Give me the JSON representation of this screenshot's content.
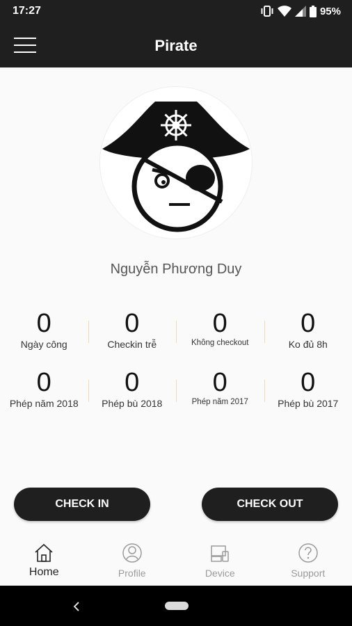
{
  "status_bar": {
    "time": "17:27",
    "battery_percent": "95%",
    "icons": [
      "vibrate-icon",
      "wifi-icon",
      "signal-icon",
      "battery-icon"
    ]
  },
  "app_bar": {
    "title": "Pirate",
    "menu_icon": "hamburger-menu-icon"
  },
  "profile": {
    "avatar_icon": "pirate-avatar-icon",
    "name": "Nguyễn Phương Duy"
  },
  "stats": {
    "row1": [
      {
        "value": "0",
        "label": "Ngày công"
      },
      {
        "value": "0",
        "label": "Checkin trễ"
      },
      {
        "value": "0",
        "label": "Không checkout"
      },
      {
        "value": "0",
        "label": "Ko đủ 8h"
      }
    ],
    "row2": [
      {
        "value": "0",
        "label": "Phép năm 2018"
      },
      {
        "value": "0",
        "label": "Phép bù 2018"
      },
      {
        "value": "0",
        "label": "Phép năm 2017"
      },
      {
        "value": "0",
        "label": "Phép bù 2017"
      }
    ]
  },
  "actions": {
    "check_in": "CHECK IN",
    "check_out": "CHECK OUT"
  },
  "bottom_nav": {
    "items": [
      {
        "label": "Home",
        "icon": "home-icon",
        "active": true
      },
      {
        "label": "Profile",
        "icon": "profile-icon",
        "active": false
      },
      {
        "label": "Device",
        "icon": "device-icon",
        "active": false
      },
      {
        "label": "Support",
        "icon": "help-icon",
        "active": false
      }
    ]
  },
  "colors": {
    "bar_dark": "#1f1f1f",
    "divider": "#f0d9b5",
    "background": "#fafafa"
  }
}
